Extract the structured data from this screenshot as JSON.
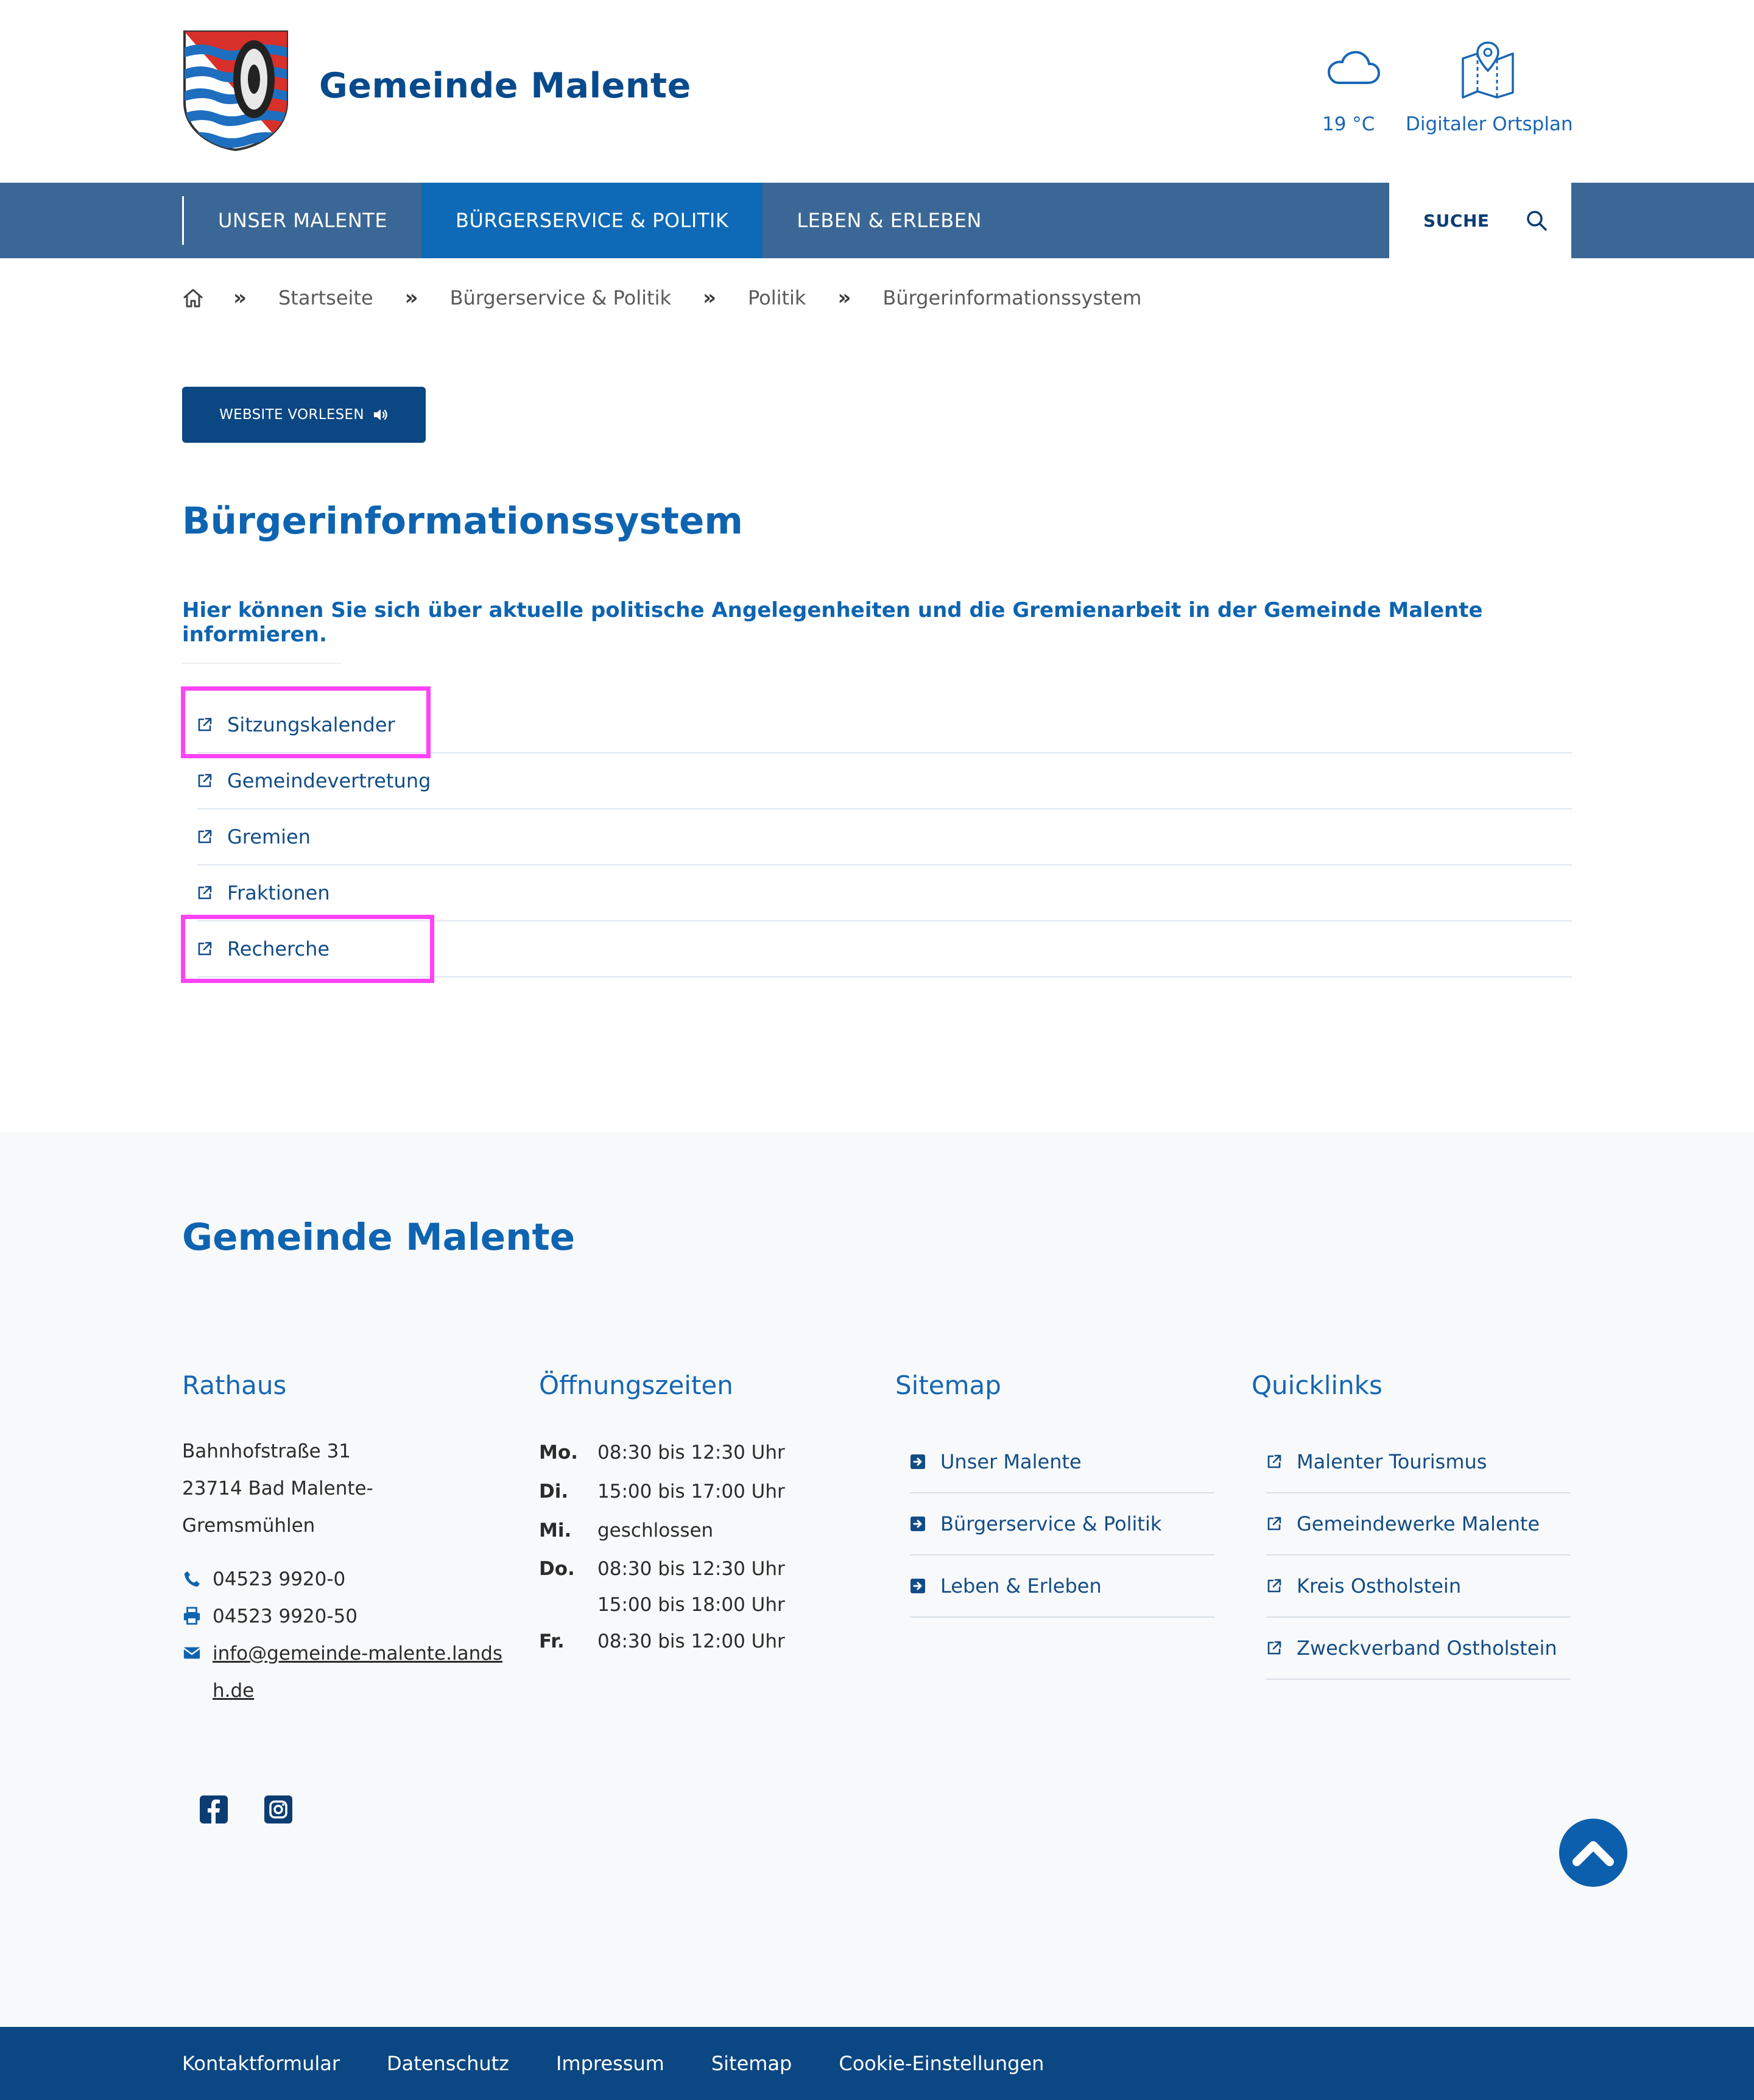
{
  "header": {
    "site_title": "Gemeinde Malente",
    "weather": {
      "temperature": "19 °C",
      "icon": "cloud-icon"
    },
    "map_link": {
      "label": "Digitaler Ortsplan",
      "icon": "map-pin-icon"
    }
  },
  "nav": {
    "items": [
      {
        "label": "UNSER MALENTE",
        "active": false
      },
      {
        "label": "BÜRGERSERVICE & POLITIK",
        "active": true
      },
      {
        "label": "LEBEN & ERLEBEN",
        "active": false
      }
    ],
    "search_label": "SUCHE"
  },
  "breadcrumb": {
    "items": [
      "Startseite",
      "Bürgerservice & Politik",
      "Politik",
      "Bürgerinformationssystem"
    ]
  },
  "read_button": {
    "label": "WEBSITE VORLESEN"
  },
  "main": {
    "title": "Bürgerinformationssystem",
    "intro": "Hier können Sie sich über aktuelle politische Angelegenheiten und die Gremienarbeit in der Gemeinde Malente informieren.",
    "links": [
      {
        "label": "Sitzungskalender",
        "highlighted": true
      },
      {
        "label": "Gemeindevertretung",
        "highlighted": false
      },
      {
        "label": "Gremien",
        "highlighted": false
      },
      {
        "label": "Fraktionen",
        "highlighted": false
      },
      {
        "label": "Recherche",
        "highlighted": true
      }
    ]
  },
  "footer": {
    "title": "Gemeinde Malente",
    "rathaus": {
      "heading": "Rathaus",
      "address_line1": "Bahnhofstraße 31",
      "address_line2": "23714 Bad Malente-",
      "address_line3": "Gremsmühlen",
      "phone": "04523 9920-0",
      "fax": "04523 9920-50",
      "email_line1": "info@gemeinde-malente.lands",
      "email_line2": "h.de"
    },
    "hours": {
      "heading": "Öffnungszeiten",
      "rows": [
        {
          "day": "Mo.",
          "time": "08:30 bis 12:30 Uhr"
        },
        {
          "day": "Di.",
          "time": "15:00 bis 17:00 Uhr"
        },
        {
          "day": "Mi.",
          "time": "geschlossen"
        },
        {
          "day": "Do.",
          "time": "08:30  bis 12:30 Uhr"
        },
        {
          "day": "",
          "time": "15:00  bis 18:00 Uhr"
        },
        {
          "day": "Fr.",
          "time": "08:30  bis 12:00 Uhr"
        }
      ]
    },
    "sitemap": {
      "heading": "Sitemap",
      "items": [
        "Unser Malente",
        "Bürgerservice & Politik",
        "Leben & Erleben"
      ]
    },
    "quicklinks": {
      "heading": "Quicklinks",
      "items": [
        "Malenter Tourismus",
        "Gemeindewerke Malente",
        "Kreis Ostholstein",
        "Zweckverband Ostholstein"
      ]
    }
  },
  "bottom_bar": {
    "links": [
      "Kontaktformular",
      "Datenschutz",
      "Impressum",
      "Sitemap",
      "Cookie-Einstellungen"
    ]
  },
  "colors": {
    "brand_blue": "#0e64b0",
    "nav_bg": "#3a6796",
    "nav_active": "#0e6ab6",
    "dark_blue": "#0b4782",
    "highlight_magenta": "#ff43f5"
  }
}
